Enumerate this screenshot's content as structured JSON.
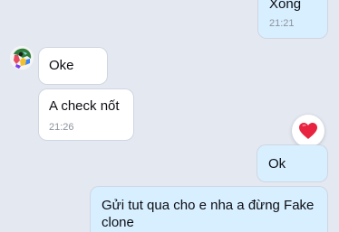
{
  "messages": [
    {
      "direction": "sent",
      "text": "Xong",
      "time": "21:21"
    },
    {
      "direction": "received",
      "text": "Oke"
    },
    {
      "direction": "received",
      "text": "A check nốt",
      "time": "21:26"
    },
    {
      "direction": "sent",
      "text": "Ok",
      "reaction": "heart-icon"
    },
    {
      "direction": "sent",
      "text_line1": "Gửi tut qua cho e nha a đừng Fake",
      "text_line2": "clone"
    }
  ],
  "colors": {
    "background": "#e4e8f1",
    "received_bubble": "#ffffff",
    "sent_bubble": "#d8efff",
    "heart": "#e8233f",
    "time_text": "#8c929c"
  }
}
